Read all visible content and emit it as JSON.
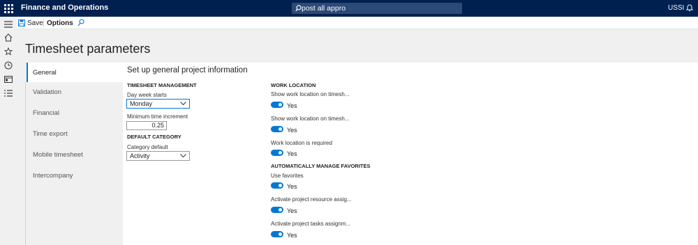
{
  "topbar": {
    "app_title": "Finance and Operations",
    "search_text": "post all appro",
    "company": "USSI"
  },
  "actionbar": {
    "save_label": "Save",
    "options_label": "Options"
  },
  "page": {
    "title": "Timesheet parameters"
  },
  "tabs": [
    {
      "label": "General",
      "active": true
    },
    {
      "label": "Validation"
    },
    {
      "label": "Financial"
    },
    {
      "label": "Time export"
    },
    {
      "label": "Mobile timesheet"
    },
    {
      "label": "Intercompany"
    }
  ],
  "content": {
    "section_title": "Set up general project information",
    "timesheet_management": {
      "heading": "TIMESHEET MANAGEMENT",
      "day_week_starts_label": "Day week starts",
      "day_week_starts_value": "Monday",
      "min_increment_label": "Minimum time increment",
      "min_increment_value": "0.25"
    },
    "default_category": {
      "heading": "DEFAULT CATEGORY",
      "category_default_label": "Category default",
      "category_default_value": "Activity"
    },
    "work_location": {
      "heading": "WORK LOCATION",
      "toggles": [
        {
          "label": "Show work location on timesh...",
          "value": "Yes"
        },
        {
          "label": "Show work location on timesh...",
          "value": "Yes"
        },
        {
          "label": "Work location is required",
          "value": "Yes"
        }
      ]
    },
    "favorites": {
      "heading": "AUTOMATICALLY MANAGE FAVORITES",
      "toggles": [
        {
          "label": "Use favorites",
          "value": "Yes"
        },
        {
          "label": "Activate project resource assig...",
          "value": "Yes"
        },
        {
          "label": "Activate project tasks assignm...",
          "value": "Yes"
        }
      ]
    }
  },
  "colors": {
    "topbar": "#002050",
    "accent": "#0078d4"
  }
}
